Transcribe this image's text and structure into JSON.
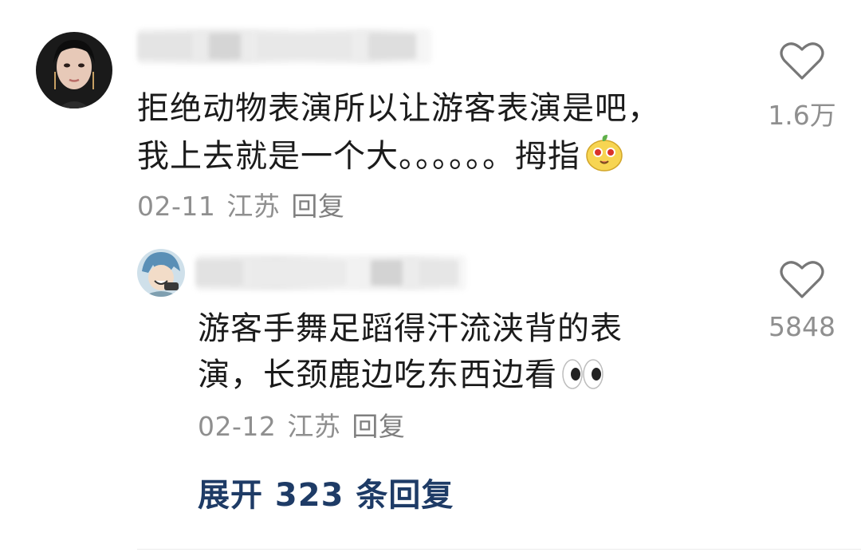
{
  "comments": [
    {
      "text_line1": "拒绝动物表演所以让游客表演是吧，",
      "text_line2": "我上去就是一个大。。。。。。拇指",
      "emoji": "mango-face-emoji",
      "date": "02-11",
      "location": "江苏",
      "reply_label": "回复",
      "likes": "1.6万"
    },
    {
      "text_line1": "游客手舞足蹈得汗流浃背的表",
      "text_line2": "演，长颈鹿边吃东西边看",
      "emoji": "eyes-emoji",
      "date": "02-12",
      "location": "江苏",
      "reply_label": "回复",
      "likes": "5848"
    }
  ],
  "expand_replies": "展开 323 条回复",
  "icons": {
    "like": "heart-outline-icon"
  },
  "colors": {
    "text": "#1b1b1b",
    "meta": "#8f8f8f",
    "expand": "#1e3b66"
  }
}
